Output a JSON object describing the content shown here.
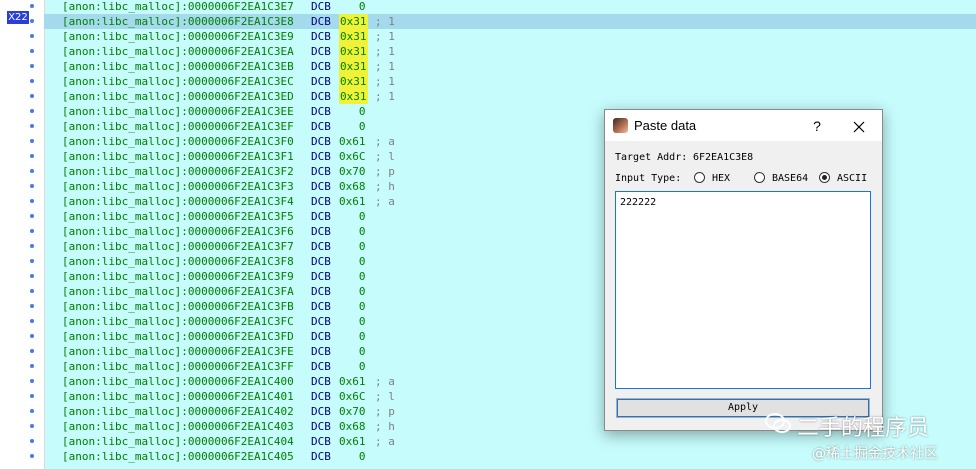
{
  "xref_badge": "X22",
  "listing": [
    {
      "addr": "[anon:libc_malloc]:0000006F2EA1C3E7",
      "mnemonic": "DCB",
      "operand": "   0",
      "comment": ""
    },
    {
      "addr": "[anon:libc_malloc]:0000006F2EA1C3E8",
      "mnemonic": "DCB",
      "operand": "0x31",
      "comment": "; 1",
      "selected": true,
      "highlight": true
    },
    {
      "addr": "[anon:libc_malloc]:0000006F2EA1C3E9",
      "mnemonic": "DCB",
      "operand": "0x31",
      "comment": "; 1",
      "highlight": true
    },
    {
      "addr": "[anon:libc_malloc]:0000006F2EA1C3EA",
      "mnemonic": "DCB",
      "operand": "0x31",
      "comment": "; 1",
      "highlight": true
    },
    {
      "addr": "[anon:libc_malloc]:0000006F2EA1C3EB",
      "mnemonic": "DCB",
      "operand": "0x31",
      "comment": "; 1",
      "highlight": true
    },
    {
      "addr": "[anon:libc_malloc]:0000006F2EA1C3EC",
      "mnemonic": "DCB",
      "operand": "0x31",
      "comment": "; 1",
      "highlight": true
    },
    {
      "addr": "[anon:libc_malloc]:0000006F2EA1C3ED",
      "mnemonic": "DCB",
      "operand": "0x31",
      "comment": "; 1",
      "highlight": true
    },
    {
      "addr": "[anon:libc_malloc]:0000006F2EA1C3EE",
      "mnemonic": "DCB",
      "operand": "   0",
      "comment": ""
    },
    {
      "addr": "[anon:libc_malloc]:0000006F2EA1C3EF",
      "mnemonic": "DCB",
      "operand": "   0",
      "comment": ""
    },
    {
      "addr": "[anon:libc_malloc]:0000006F2EA1C3F0",
      "mnemonic": "DCB",
      "operand": "0x61",
      "comment": "; a"
    },
    {
      "addr": "[anon:libc_malloc]:0000006F2EA1C3F1",
      "mnemonic": "DCB",
      "operand": "0x6C",
      "comment": "; l"
    },
    {
      "addr": "[anon:libc_malloc]:0000006F2EA1C3F2",
      "mnemonic": "DCB",
      "operand": "0x70",
      "comment": "; p"
    },
    {
      "addr": "[anon:libc_malloc]:0000006F2EA1C3F3",
      "mnemonic": "DCB",
      "operand": "0x68",
      "comment": "; h"
    },
    {
      "addr": "[anon:libc_malloc]:0000006F2EA1C3F4",
      "mnemonic": "DCB",
      "operand": "0x61",
      "comment": "; a"
    },
    {
      "addr": "[anon:libc_malloc]:0000006F2EA1C3F5",
      "mnemonic": "DCB",
      "operand": "   0",
      "comment": ""
    },
    {
      "addr": "[anon:libc_malloc]:0000006F2EA1C3F6",
      "mnemonic": "DCB",
      "operand": "   0",
      "comment": ""
    },
    {
      "addr": "[anon:libc_malloc]:0000006F2EA1C3F7",
      "mnemonic": "DCB",
      "operand": "   0",
      "comment": ""
    },
    {
      "addr": "[anon:libc_malloc]:0000006F2EA1C3F8",
      "mnemonic": "DCB",
      "operand": "   0",
      "comment": ""
    },
    {
      "addr": "[anon:libc_malloc]:0000006F2EA1C3F9",
      "mnemonic": "DCB",
      "operand": "   0",
      "comment": ""
    },
    {
      "addr": "[anon:libc_malloc]:0000006F2EA1C3FA",
      "mnemonic": "DCB",
      "operand": "   0",
      "comment": ""
    },
    {
      "addr": "[anon:libc_malloc]:0000006F2EA1C3FB",
      "mnemonic": "DCB",
      "operand": "   0",
      "comment": ""
    },
    {
      "addr": "[anon:libc_malloc]:0000006F2EA1C3FC",
      "mnemonic": "DCB",
      "operand": "   0",
      "comment": ""
    },
    {
      "addr": "[anon:libc_malloc]:0000006F2EA1C3FD",
      "mnemonic": "DCB",
      "operand": "   0",
      "comment": ""
    },
    {
      "addr": "[anon:libc_malloc]:0000006F2EA1C3FE",
      "mnemonic": "DCB",
      "operand": "   0",
      "comment": ""
    },
    {
      "addr": "[anon:libc_malloc]:0000006F2EA1C3FF",
      "mnemonic": "DCB",
      "operand": "   0",
      "comment": ""
    },
    {
      "addr": "[anon:libc_malloc]:0000006F2EA1C400",
      "mnemonic": "DCB",
      "operand": "0x61",
      "comment": "; a"
    },
    {
      "addr": "[anon:libc_malloc]:0000006F2EA1C401",
      "mnemonic": "DCB",
      "operand": "0x6C",
      "comment": "; l"
    },
    {
      "addr": "[anon:libc_malloc]:0000006F2EA1C402",
      "mnemonic": "DCB",
      "operand": "0x70",
      "comment": "; p"
    },
    {
      "addr": "[anon:libc_malloc]:0000006F2EA1C403",
      "mnemonic": "DCB",
      "operand": "0x68",
      "comment": "; h"
    },
    {
      "addr": "[anon:libc_malloc]:0000006F2EA1C404",
      "mnemonic": "DCB",
      "operand": "0x61",
      "comment": "; a"
    },
    {
      "addr": "[anon:libc_malloc]:0000006F2EA1C405",
      "mnemonic": "DCB",
      "operand": "   0",
      "comment": ""
    }
  ],
  "dialog": {
    "title": "Paste data",
    "help_label": "?",
    "target_addr_label": "Target Addr:",
    "target_addr_value": "6F2EA1C3E8",
    "input_type_label": "Input Type:",
    "options": [
      {
        "label": "HEX",
        "checked": false
      },
      {
        "label": "BASE64",
        "checked": false
      },
      {
        "label": "ASCII",
        "checked": true
      }
    ],
    "input_value": "222222",
    "apply_label": "Apply"
  },
  "watermark": {
    "line1": "二手的程序员",
    "line2": "@稀土掘金技术社区"
  },
  "colors": {
    "background": "#c6fcfc",
    "address": "#008000",
    "mnemonic": "#000080",
    "highlight": "#f0f23a",
    "selection": "#a5d9ec",
    "xref_badge": "#2a3fd6"
  }
}
